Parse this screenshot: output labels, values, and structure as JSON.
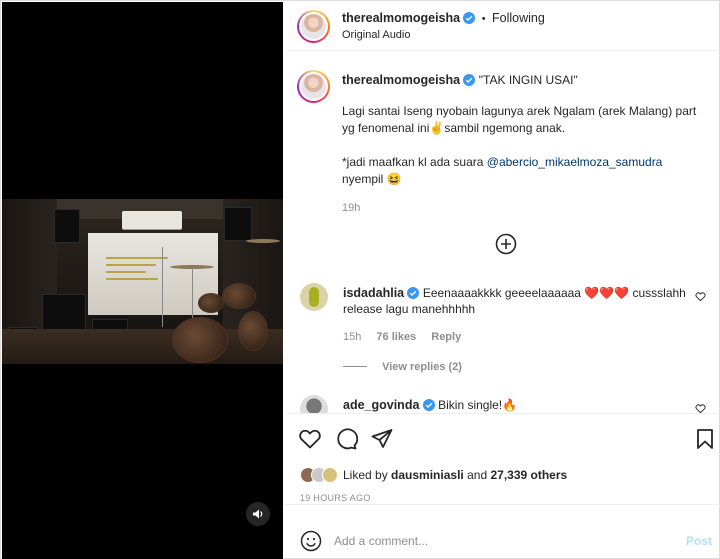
{
  "colors": {
    "accent": "#0095f6",
    "mention": "#00376b",
    "muted": "#8e8e8e",
    "heart": "#ed4956"
  },
  "header": {
    "username": "therealmomogeisha",
    "bullet": "•",
    "follow_status": "Following",
    "audio": "Original Audio"
  },
  "caption": {
    "username": "therealmomogeisha",
    "title": "\"TAK INGIN USAI\"",
    "line1": "Lagi santai Iseng nyobain lagunya arek Ngalam (arek Malang) part yg fenomenal ini",
    "emoji1": "✌️",
    "line1b": "sambil ngemong anak.",
    "line2a": "*jadi maafkan kl ada suara",
    "mention": "@abercio_mikaelmoza_samudra",
    "line2b": "nyempil",
    "emoji2": "😆",
    "time": "19h"
  },
  "comments": [
    {
      "username": "isdadahlia",
      "text": "Eeenaaaakkkk geeeelaaaaaa",
      "hearts": "❤️❤️❤️",
      "text2": "cussslahh release lagu manehhhhh",
      "time": "15h",
      "likes": "76 likes",
      "reply": "Reply",
      "view_replies": "View replies (2)"
    },
    {
      "username": "ade_govinda",
      "text": "Bikin single!",
      "emoji": "🔥"
    }
  ],
  "actions": {
    "liked_by_prefix": "Liked by",
    "liked_by_user": "dausminiasli",
    "liked_by_and": "and",
    "liked_by_count": "27,339 others",
    "timestamp": "19 HOURS AGO"
  },
  "add_comment": {
    "placeholder": "Add a comment...",
    "post_label": "Post"
  },
  "icons": [
    "sound-icon",
    "verified-icon",
    "add-circle-icon",
    "heart-icon",
    "comment-icon",
    "share-icon",
    "save-icon",
    "emoji-icon"
  ]
}
